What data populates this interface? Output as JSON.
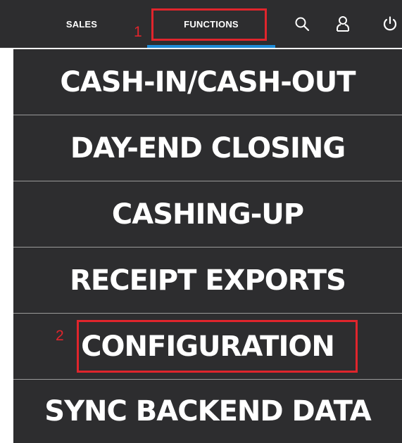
{
  "header": {
    "tabs": [
      {
        "label": "SALES",
        "active": false
      },
      {
        "label": "FUNCTIONS",
        "active": true
      }
    ],
    "icons": [
      "search-icon",
      "user-icon",
      "power-icon"
    ],
    "accent_color": "#1e8bd8"
  },
  "menu": {
    "items": [
      {
        "label": "CASH-IN/CASH-OUT"
      },
      {
        "label": "DAY-END CLOSING"
      },
      {
        "label": "CASHING-UP"
      },
      {
        "label": "RECEIPT EXPORTS"
      },
      {
        "label": "CONFIGURATION"
      },
      {
        "label": "SYNC BACKEND DATA"
      }
    ]
  },
  "annotations": {
    "color": "#e0252c",
    "steps": [
      {
        "label": "1"
      },
      {
        "label": "2"
      }
    ]
  }
}
